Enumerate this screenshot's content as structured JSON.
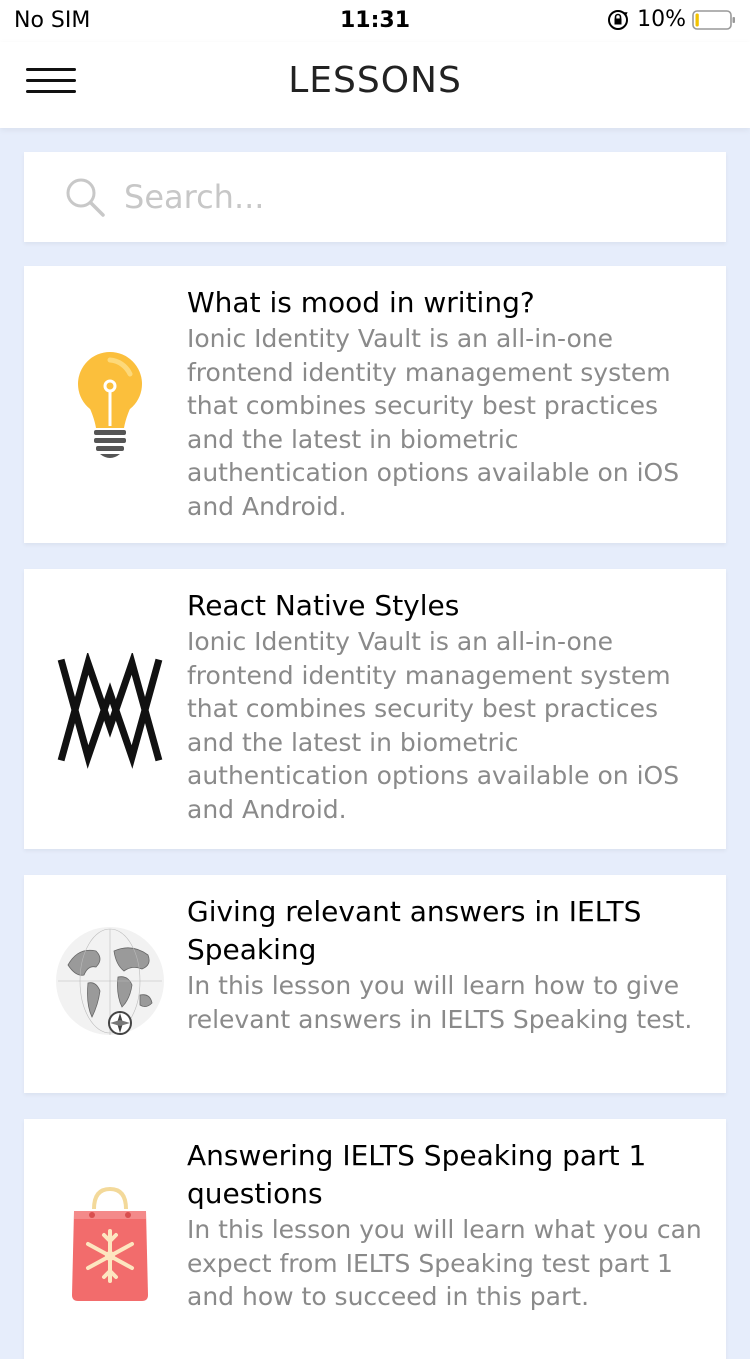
{
  "status_bar": {
    "carrier": "No SIM",
    "time": "11:31",
    "battery_percent": "10%",
    "battery_level": 0.1,
    "battery_color": "#f2c200",
    "icons": [
      "orientation-lock-icon",
      "battery-icon"
    ]
  },
  "header": {
    "title": "LESSONS",
    "menu_icon": "hamburger-menu-icon"
  },
  "search": {
    "placeholder": "Search...",
    "value": "",
    "icon": "search-icon"
  },
  "lessons": [
    {
      "title": "What is mood in writing?",
      "description": "Ionic Identity Vault is an all-in-one frontend identity management system that combines security best practices and the latest in biometric authentication options available on iOS and Android.",
      "thumbnail": "lightbulb-icon"
    },
    {
      "title": "React Native Styles",
      "description": "Ionic Identity Vault is an all-in-one frontend identity management system that combines security best practices and the latest in biometric authentication options available on iOS and Android.",
      "thumbnail": "aw-logo-icon"
    },
    {
      "title": "Giving relevant answers in IELTS Speaking",
      "description": "In this lesson you will learn how to give relevant answers in IELTS Speaking test.",
      "thumbnail": "world-map-globe-icon"
    },
    {
      "title": "Answering IELTS Speaking part 1 questions",
      "description": "In this lesson you will learn what you can expect from IELTS Speaking test part 1 and how to succeed in this part.",
      "thumbnail": "snowflake-gift-bag-icon"
    }
  ]
}
